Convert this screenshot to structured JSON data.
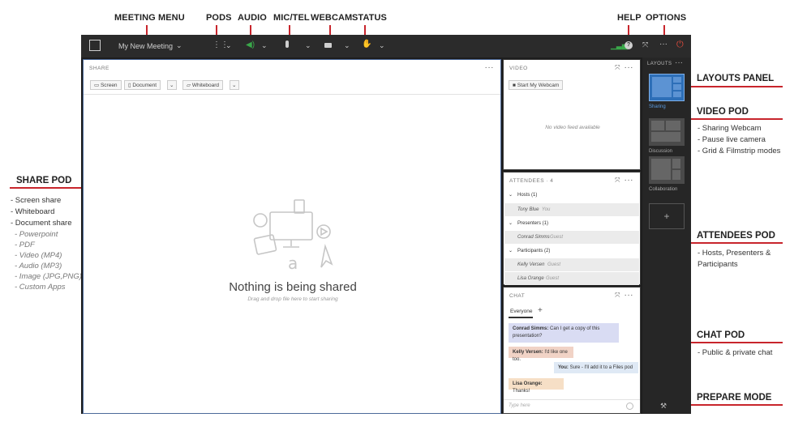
{
  "callouts": {
    "top": {
      "meeting_menu": "MEETING MENU",
      "pods": "PODS",
      "audio": "AUDIO",
      "mic_tel": "MIC/TEL",
      "webcam": "WEBCAM",
      "status": "STATUS",
      "help": "HELP",
      "options": "OPTIONS"
    },
    "share_pod": {
      "title": "SHARE POD",
      "items": [
        "- Screen share",
        "- Whiteboard",
        "- Document share"
      ],
      "formats": [
        "- Powerpoint",
        "- PDF",
        "- Video (MP4)",
        "- Audio (MP3)",
        "- Image (JPG,PNG)",
        "- Custom Apps"
      ]
    },
    "layouts_panel": {
      "title": "LAYOUTS PANEL"
    },
    "video_pod": {
      "title": "VIDEO POD",
      "items": [
        "- Sharing Webcam",
        "- Pause live camera",
        "- Grid & Filmstrip modes"
      ]
    },
    "attendees_pod": {
      "title": "ATTENDEES POD",
      "items": [
        "- Hosts, Presenters &",
        "  Participants"
      ]
    },
    "chat_pod": {
      "title": "CHAT POD",
      "items": [
        "- Public & private chat"
      ]
    },
    "prepare_mode": {
      "title": "PREPARE MODE"
    }
  },
  "topbar": {
    "meeting_name": "My New Meeting"
  },
  "share": {
    "title": "SHARE",
    "buttons": {
      "screen": "Screen",
      "document": "Document",
      "whiteboard": "Whiteboard"
    },
    "empty_title": "Nothing is being shared",
    "empty_hint": "Drag and drop file here to start sharing"
  },
  "video": {
    "title": "VIDEO",
    "start_webcam": "Start My Webcam",
    "no_feed": "No video feed available"
  },
  "attendees": {
    "title": "ATTENDEES · 4",
    "groups": [
      {
        "label": "Hosts (1)",
        "members": [
          {
            "name": "Tony Blue",
            "tag": "You"
          }
        ]
      },
      {
        "label": "Presenters (1)",
        "members": [
          {
            "name": "Conrad Simms",
            "tag": "Guest"
          }
        ]
      },
      {
        "label": "Participants (2)",
        "members": [
          {
            "name": "Kelly Versen",
            "tag": "Guest"
          },
          {
            "name": "Lisa Orange",
            "tag": "Guest"
          }
        ]
      }
    ]
  },
  "chat": {
    "title": "CHAT",
    "tab": "Everyone",
    "add_tab": "+",
    "messages": [
      {
        "sender": "Conrad Simms:",
        "text": "Can I get a copy of this presentation?",
        "color": "#d9dcf3"
      },
      {
        "sender": "Kelly Versen:",
        "text": "I'd like one too.",
        "color": "#f1d3c6"
      },
      {
        "sender": "You:",
        "text": "Sure - I'll add it to a Files pod",
        "color": "#dfe9f5"
      },
      {
        "sender": "Lisa Orange:",
        "text": "Thanks!",
        "color": "#f6dfc6"
      }
    ],
    "input_placeholder": "Type here"
  },
  "layouts": {
    "title": "LAYOUTS",
    "items": [
      "Sharing",
      "Discussion",
      "Collaboration"
    ],
    "add": "+"
  },
  "colors": {
    "accent_red": "#c8252c",
    "selected_blue": "#2d6fb8",
    "audio_green": "#3aa84a"
  }
}
